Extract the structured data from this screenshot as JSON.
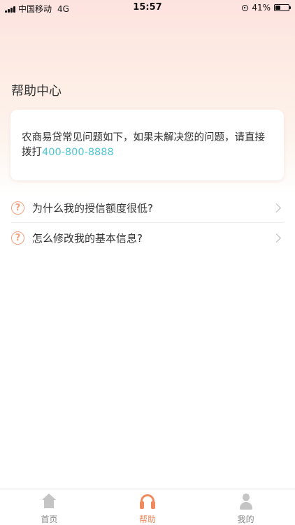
{
  "status_bar": {
    "carrier": "中国移动",
    "network": "4G",
    "time": "15:57",
    "battery": "41%",
    "battery_level": 0.41
  },
  "page": {
    "title": "帮助中心"
  },
  "notice": {
    "text": "农商易贷常见问题如下，如果未解决您的问题，请直接拨打",
    "phone": "400-800-8888",
    "phone_color": "#4ec6cf"
  },
  "faq": {
    "icon_glyph": "?",
    "items": [
      {
        "label": "为什么我的授信额度很低?"
      },
      {
        "label": "怎么修改我的基本信息?"
      }
    ]
  },
  "tab_bar": {
    "active_color": "#f08a5d",
    "tabs": [
      {
        "label": "首页",
        "icon": "home-icon",
        "active": false
      },
      {
        "label": "帮助",
        "icon": "headset-icon",
        "active": true
      },
      {
        "label": "我的",
        "icon": "user-icon",
        "active": false
      }
    ]
  }
}
